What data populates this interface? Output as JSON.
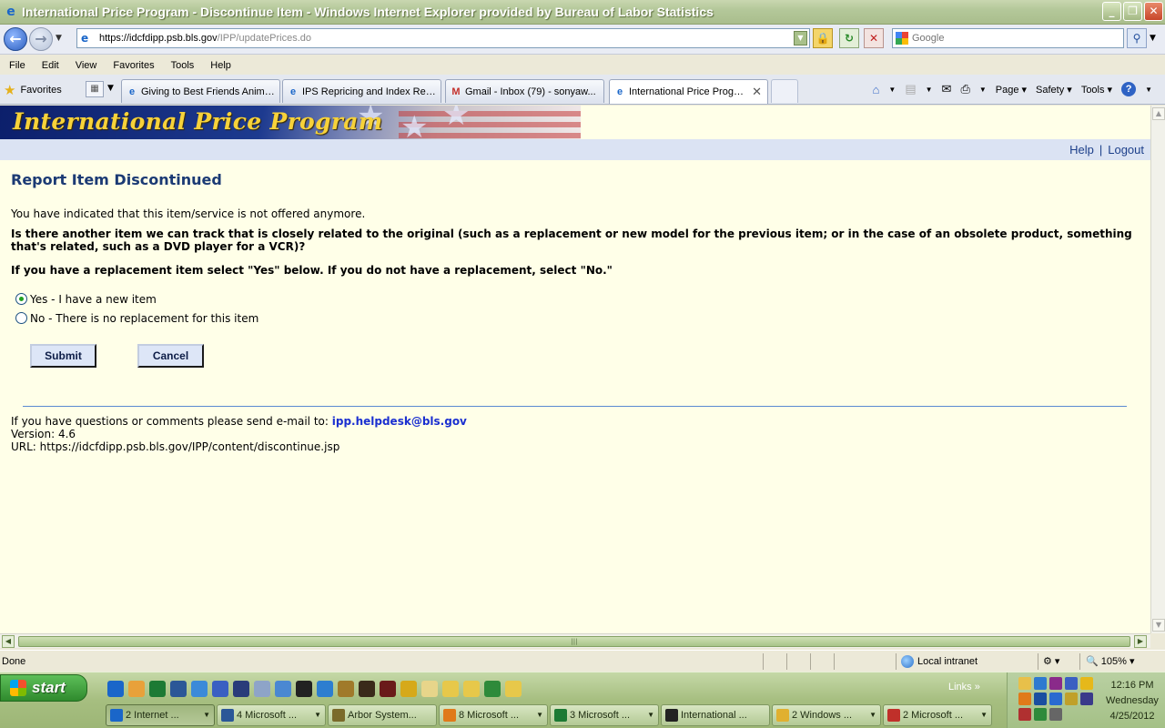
{
  "window": {
    "title": "International Price Program - Discontinue Item - Windows Internet Explorer provided by Bureau of Labor Statistics",
    "buttons": [
      "_",
      "❐",
      "✕"
    ]
  },
  "address_bar": {
    "url_host": "https://idcfdipp.psb.bls.gov",
    "url_path": "/IPP/updatePrices.do",
    "search_placeholder": "Google"
  },
  "menu": [
    "File",
    "Edit",
    "View",
    "Favorites",
    "Tools",
    "Help"
  ],
  "favorites_label": "Favorites",
  "tabs": [
    {
      "label": "Giving to Best Friends Animal...",
      "icon": "ie-icon"
    },
    {
      "label": "IPS Repricing and Index Revi...",
      "icon": "ie-icon"
    },
    {
      "label": "Gmail - Inbox (79) - sonyaw...",
      "icon": "gmail-icon"
    },
    {
      "label": "International Price Progra...",
      "icon": "ie-icon",
      "active": true
    }
  ],
  "command_bar": {
    "page": "Page",
    "safety": "Safety",
    "tools": "Tools"
  },
  "site": {
    "banner_title": "International Price Program",
    "nav_help": "Help",
    "nav_separator": "|",
    "nav_logout": "Logout"
  },
  "content": {
    "heading": "Report Item Discontinued",
    "intro": "You have indicated that this item/service is not offered anymore.",
    "question": "Is there another item we can track that is closely related to the original (such as a replacement or new model for the previous item; or in the case of an obsolete product, something that's related, such as a DVD player for a VCR)?",
    "instruction": "If you have a replacement item select \"Yes\" below. If you do not have a replacement, select \"No.\"",
    "options": [
      {
        "label": "Yes - I have a new item",
        "selected": true
      },
      {
        "label": "No - There is no replacement for this item",
        "selected": false
      }
    ],
    "submit_label": "Submit",
    "cancel_label": "Cancel"
  },
  "footer": {
    "contact_text": "If you have questions or comments please send e-mail to: ",
    "email": "ipp.helpdesk@bls.gov",
    "version": "Version: 4.6",
    "url": "URL: https://idcfdipp.psb.bls.gov/IPP/content/discontinue.jsp"
  },
  "status_bar": {
    "status": "Done",
    "zone": "Local intranet",
    "zoom": "105%"
  },
  "taskbar": {
    "start_label": "start",
    "links_label": "Links",
    "buttons": [
      {
        "label": "2 Internet ...",
        "color": "#1a66c9",
        "active": true
      },
      {
        "label": "4 Microsoft ...",
        "color": "#2b5797"
      },
      {
        "label": "Arbor System...",
        "color": "#7a6a2a"
      },
      {
        "label": "8 Microsoft ...",
        "color": "#e07a1a"
      },
      {
        "label": "3 Microsoft ...",
        "color": "#1d7a34"
      },
      {
        "label": "International ...",
        "color": "#222222"
      },
      {
        "label": "2 Windows ...",
        "color": "#e0b030"
      },
      {
        "label": "2 Microsoft ...",
        "color": "#c0302a"
      }
    ],
    "clock_time": "12:16 PM",
    "clock_day": "Wednesday",
    "clock_date": "4/25/2012"
  }
}
